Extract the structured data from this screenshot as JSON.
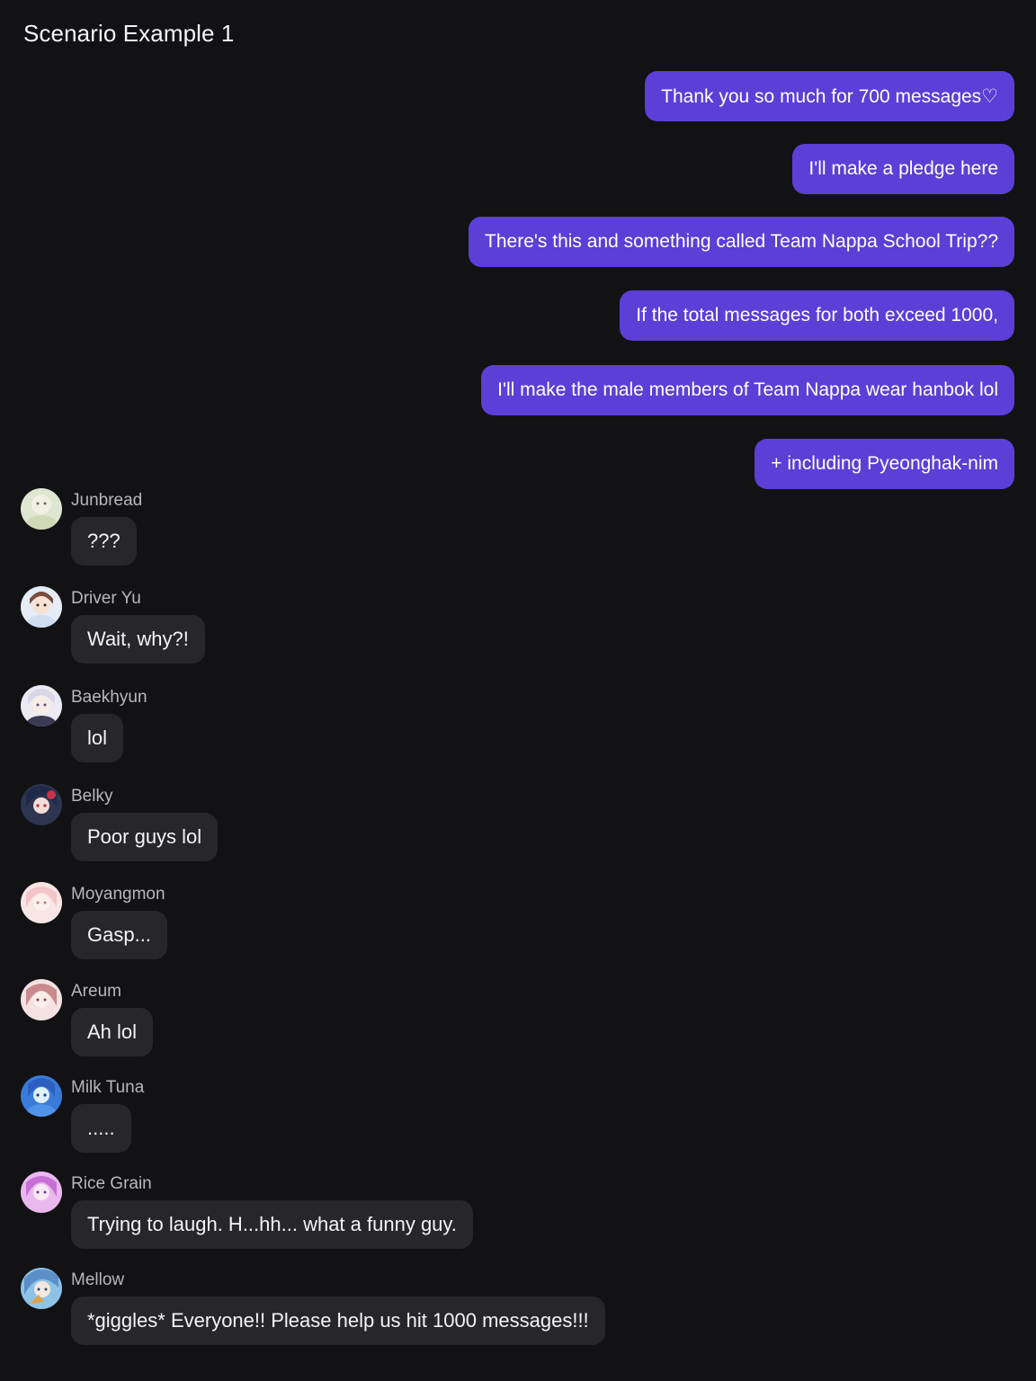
{
  "header": {
    "title": "Scenario Example 1"
  },
  "outgoing_messages": [
    {
      "text": "Thank you so much for 700 messages♡"
    },
    {
      "text": "I'll make a pledge here"
    },
    {
      "text": "There's this and something called Team Nappa School Trip??"
    },
    {
      "text": "If the total messages for both exceed 1000,"
    },
    {
      "text": "I'll make the male members of Team Nappa wear hanbok lol"
    },
    {
      "text": "+ including Pyeonghak-nim"
    }
  ],
  "incoming_messages": [
    {
      "sender": "Junbread",
      "text": "???",
      "avatar_icon": "avatar-icon"
    },
    {
      "sender": "Driver Yu",
      "text": "Wait, why?!",
      "avatar_icon": "avatar-icon"
    },
    {
      "sender": "Baekhyun",
      "text": "lol",
      "avatar_icon": "avatar-icon"
    },
    {
      "sender": "Belky",
      "text": "Poor guys lol",
      "avatar_icon": "avatar-icon"
    },
    {
      "sender": "Moyangmon",
      "text": "Gasp...",
      "avatar_icon": "avatar-icon"
    },
    {
      "sender": "Areum",
      "text": "Ah lol",
      "avatar_icon": "avatar-icon"
    },
    {
      "sender": "Milk Tuna",
      "text": ".....",
      "avatar_icon": "avatar-icon"
    },
    {
      "sender": "Rice Grain",
      "text": "Trying to laugh. H...hh... what a funny guy.",
      "avatar_icon": "avatar-icon"
    },
    {
      "sender": "Mellow",
      "text": "*giggles* Everyone!! Please help us hit 1000 messages!!!",
      "avatar_icon": "avatar-icon"
    }
  ],
  "colors": {
    "background": "#121214",
    "outgoing_bubble": "#5b3fd6",
    "incoming_bubble": "#27272b",
    "sender_name": "#b7b7bd"
  }
}
